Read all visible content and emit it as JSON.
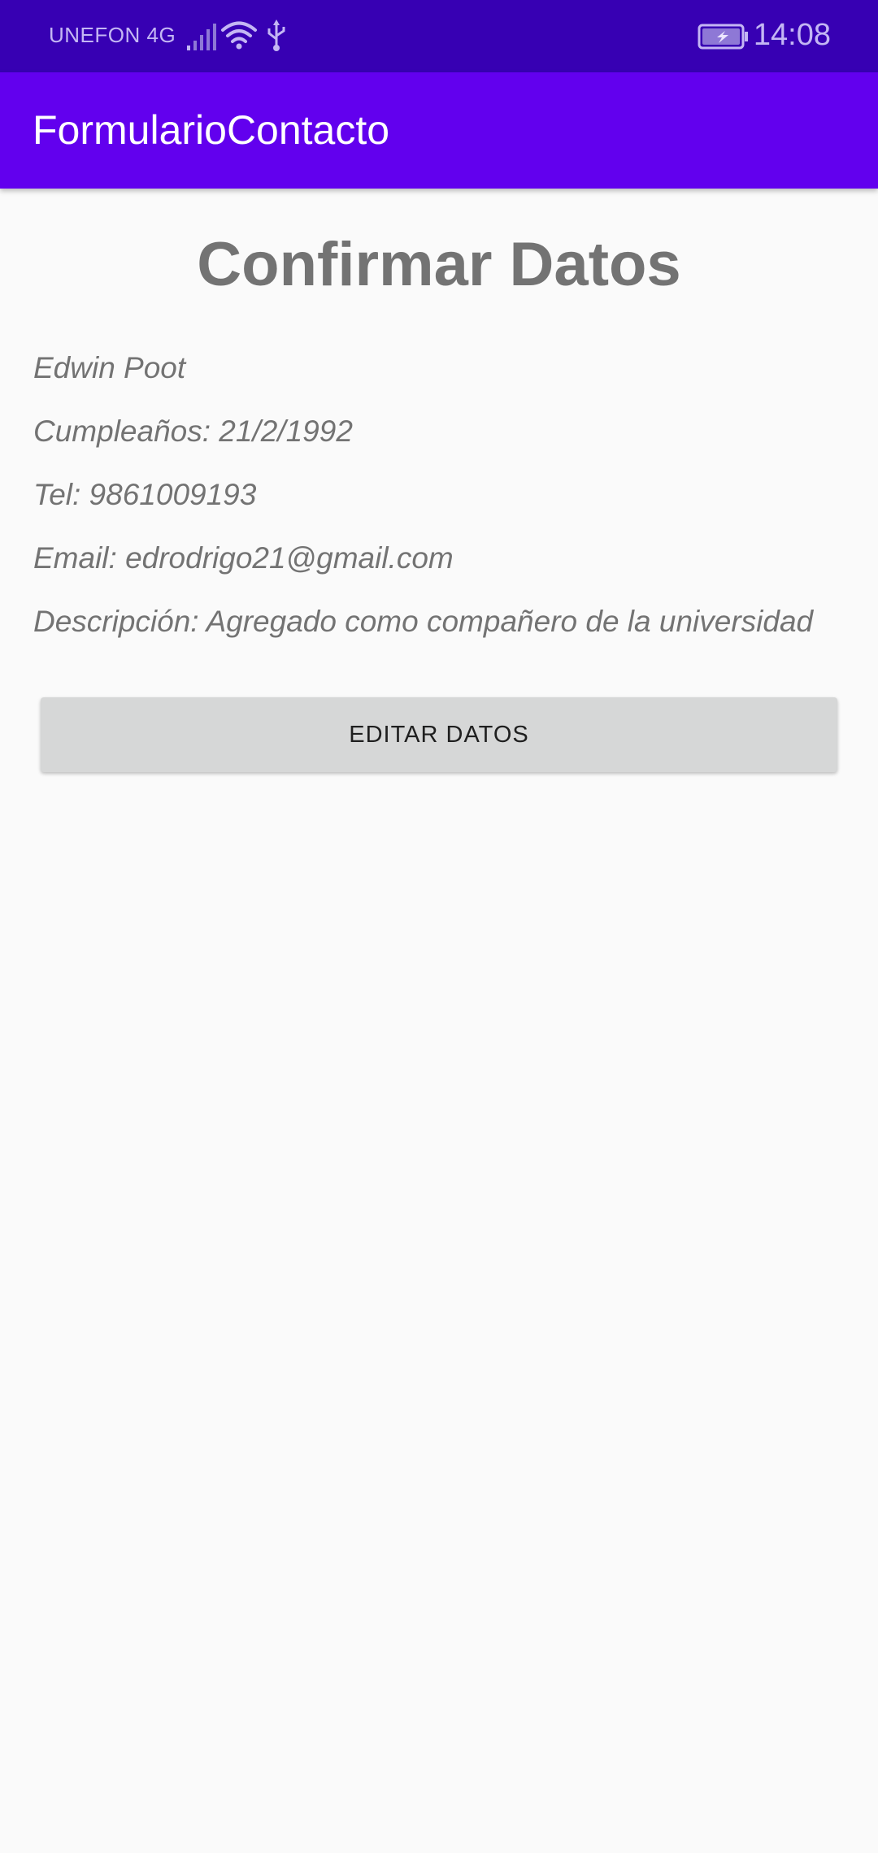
{
  "status_bar": {
    "carrier": "UNEFON 4G",
    "time": "14:08",
    "icons": [
      "signal-icon",
      "wifi-icon",
      "usb-icon",
      "battery-charging-icon"
    ]
  },
  "app_bar": {
    "title": "FormularioContacto"
  },
  "main": {
    "heading": "Confirmar Datos",
    "details": {
      "name": "Edwin Poot",
      "birthday": "Cumpleaños: 21/2/1992",
      "phone": "Tel: 9861009193",
      "email": "Email: edrodrigo21@gmail.com",
      "description": "Descripción: Agregado como compañero de la universidad"
    },
    "edit_button_label": "EDITAR DATOS"
  },
  "colors": {
    "status_bar": "#3700b3",
    "app_bar": "#6200ee",
    "background": "#fafafa",
    "text_gray": "#737373",
    "button": "#d6d7d7"
  }
}
